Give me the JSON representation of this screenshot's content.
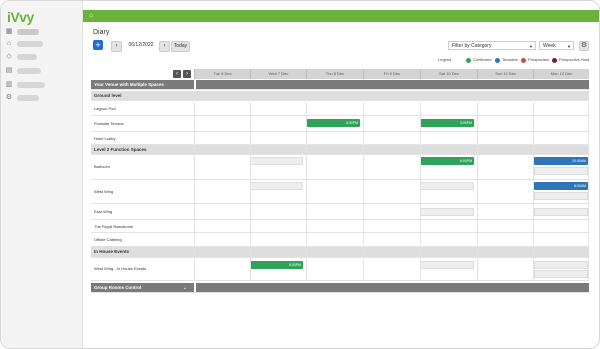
{
  "app": {
    "logo": "iVvy",
    "rail_items": [
      {
        "icon": "calendar-icon",
        "glyph": "▦"
      },
      {
        "icon": "home-icon",
        "glyph": "⌂"
      },
      {
        "icon": "tag-icon",
        "glyph": "◇"
      },
      {
        "icon": "table-icon",
        "glyph": "▤"
      },
      {
        "icon": "chart-icon",
        "glyph": "▥"
      },
      {
        "icon": "gear-icon",
        "glyph": "⚙"
      }
    ]
  },
  "header": {
    "home_icon": "home-icon",
    "title": "Diary"
  },
  "toolbar": {
    "add_label": "+",
    "prev_label": "‹",
    "next_label": "›",
    "date_value": "06/12/2022",
    "today_label": "Today",
    "filter_value": "Filter by Category",
    "view_value": "Week",
    "settings_icon": "gear-icon"
  },
  "legend": {
    "title": "Legend",
    "items": [
      {
        "label": "Confirmed",
        "color": "#2fa35a"
      },
      {
        "label": "Tentative",
        "color": "#2f74b5"
      },
      {
        "label": "Prospective",
        "color": "#c0504d"
      },
      {
        "label": "Prospective Hold",
        "color": "#7b1f1f"
      }
    ]
  },
  "grid": {
    "days": [
      "Tue 6 Dec",
      "Wed 7 Dec",
      "Thu 8 Dec",
      "Fri 9 Dec",
      "Sat 10 Dec",
      "Sun 11 Dec",
      "Mon 12 Dec"
    ],
    "venue": "Your Venue with Multiple Spaces",
    "sections": [
      {
        "title": "Ground level",
        "rows": [
          "Lagoon Pod",
          "Poolside Terrace",
          "Hotel Lobby"
        ]
      },
      {
        "title": "Level 2 Function Spaces",
        "rows": [
          "Ballroom",
          "West Wing",
          "East Wing",
          "The Royal Boardroom",
          "Offsite Catering"
        ]
      },
      {
        "title": "In House Events",
        "rows": [
          "West Wing - In House Events"
        ]
      }
    ],
    "footer_group": "Group Rooms Control",
    "bookings": {
      "poolside_thu": "6:30PM",
      "poolside_sat": "3:00PM",
      "ballroom_sat": "6:00PM",
      "ballroom_mon": "10:00AM",
      "westwing_mon": "8:00AM",
      "inhouse_wed": "6:30PM"
    }
  }
}
